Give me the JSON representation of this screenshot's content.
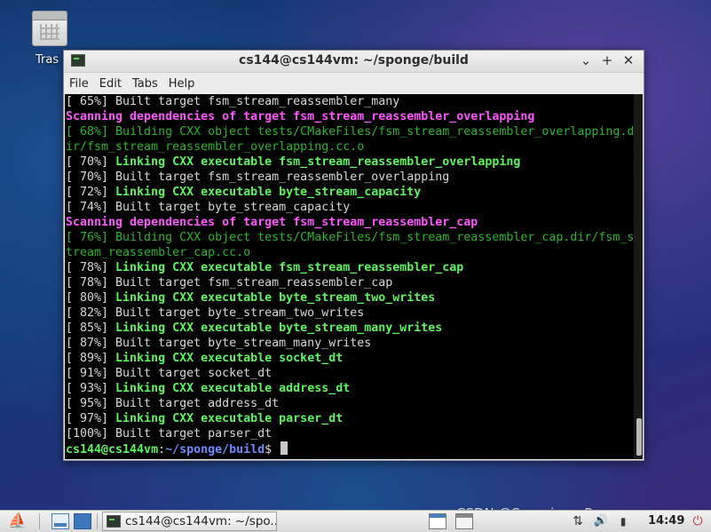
{
  "desktop": {
    "trash_label": "Tras"
  },
  "window": {
    "title": "cs144@cs144vm: ~/sponge/build",
    "controls": {
      "minimize": "⌄",
      "maximize": "+",
      "close": "✕"
    },
    "menu": [
      "File",
      "Edit",
      "Tabs",
      "Help"
    ]
  },
  "terminal": {
    "lines": [
      {
        "style": "gray",
        "text": "[ 65%] Built target fsm_stream_reassembler_many"
      },
      {
        "style": "magenta",
        "text": "Scanning dependencies of target fsm_stream_reassembler_overlapping"
      },
      {
        "style": "green",
        "text": "[ 68%] Building CXX object tests/CMakeFiles/fsm_stream_reassembler_overlapping.d"
      },
      {
        "style": "green",
        "text": "ir/fsm_stream_reassembler_overlapping.cc.o"
      },
      {
        "style": "bgreen",
        "prefix": "[ 70%] ",
        "text": "Linking CXX executable fsm_stream_reassembler_overlapping"
      },
      {
        "style": "gray",
        "text": "[ 70%] Built target fsm_stream_reassembler_overlapping"
      },
      {
        "style": "bgreen",
        "prefix": "[ 72%] ",
        "text": "Linking CXX executable byte_stream_capacity"
      },
      {
        "style": "gray",
        "text": "[ 74%] Built target byte_stream_capacity"
      },
      {
        "style": "magenta",
        "text": "Scanning dependencies of target fsm_stream_reassembler_cap"
      },
      {
        "style": "green",
        "text": "[ 76%] Building CXX object tests/CMakeFiles/fsm_stream_reassembler_cap.dir/fsm_s"
      },
      {
        "style": "green",
        "text": "tream_reassembler_cap.cc.o"
      },
      {
        "style": "bgreen",
        "prefix": "[ 78%] ",
        "text": "Linking CXX executable fsm_stream_reassembler_cap"
      },
      {
        "style": "gray",
        "text": "[ 78%] Built target fsm_stream_reassembler_cap"
      },
      {
        "style": "bgreen",
        "prefix": "[ 80%] ",
        "text": "Linking CXX executable byte_stream_two_writes"
      },
      {
        "style": "gray",
        "text": "[ 82%] Built target byte_stream_two_writes"
      },
      {
        "style": "bgreen",
        "prefix": "[ 85%] ",
        "text": "Linking CXX executable byte_stream_many_writes"
      },
      {
        "style": "gray",
        "text": "[ 87%] Built target byte_stream_many_writes"
      },
      {
        "style": "bgreen",
        "prefix": "[ 89%] ",
        "text": "Linking CXX executable socket_dt"
      },
      {
        "style": "gray",
        "text": "[ 91%] Built target socket_dt"
      },
      {
        "style": "bgreen",
        "prefix": "[ 93%] ",
        "text": "Linking CXX executable address_dt"
      },
      {
        "style": "gray",
        "text": "[ 95%] Built target address_dt"
      },
      {
        "style": "bgreen",
        "prefix": "[ 97%] ",
        "text": "Linking CXX executable parser_dt"
      },
      {
        "style": "gray",
        "text": "[100%] Built target parser_dt"
      }
    ],
    "prompt": {
      "user": "cs144@cs144vm",
      "sep": ":",
      "path": "~/sponge/build",
      "symbol": "$ "
    }
  },
  "taskbar": {
    "task_label": "cs144@cs144vm: ~/spo...",
    "clock": "14:49"
  },
  "watermark": "CSDN @Sarapines_Programmer"
}
